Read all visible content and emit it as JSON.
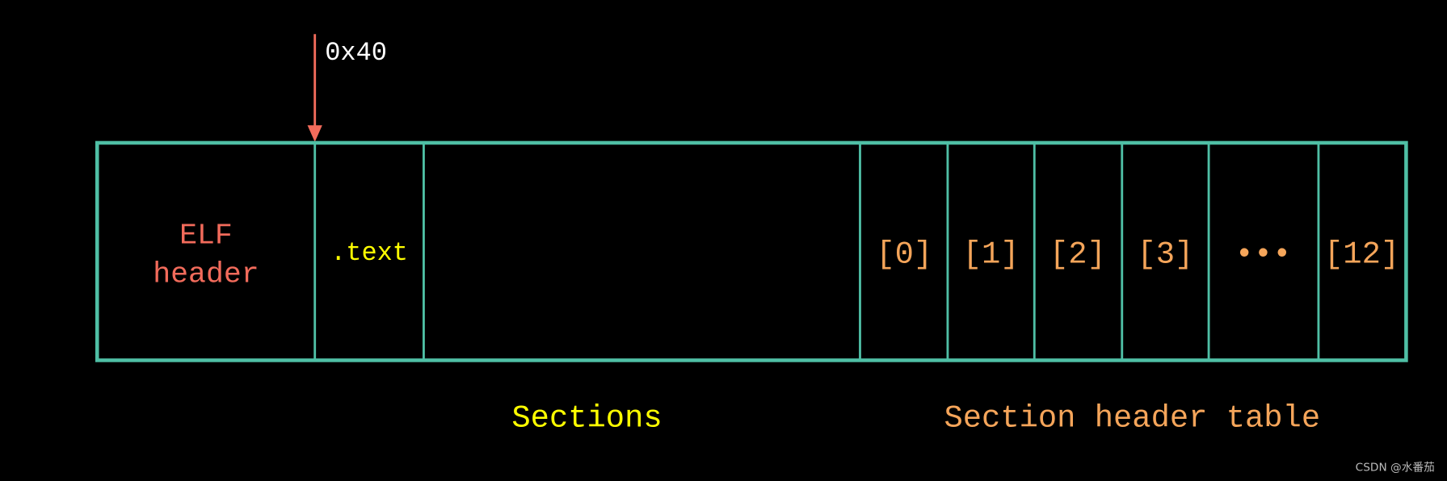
{
  "colors": {
    "background": "#000000",
    "border": "#4fbfa5",
    "arrow": "#f26b5b",
    "elf_header": "#f26b5b",
    "text_section": "#ffff00",
    "sections_label": "#ffff00",
    "section_header": "#f5a55a",
    "offset_label": "#ffffff",
    "watermark": "#bbbbbb"
  },
  "offset_label": "0x40",
  "elf_header": {
    "line1": "ELF",
    "line2": "header"
  },
  "text_section": ".text",
  "section_headers": [
    "[0]",
    "[1]",
    "[2]",
    "[3]",
    "•••",
    "[12]"
  ],
  "labels": {
    "sections": "Sections",
    "section_header_table": "Section header table"
  },
  "watermark": "CSDN @水番茄"
}
